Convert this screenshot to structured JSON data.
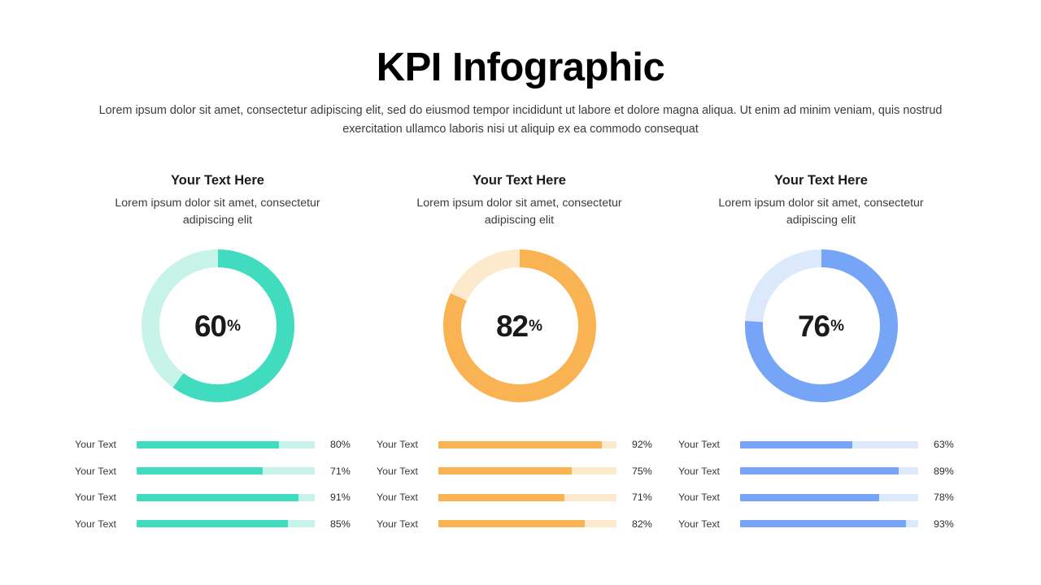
{
  "header": {
    "title": "KPI Infographic",
    "subtitle": "Lorem ipsum dolor sit amet, consectetur adipiscing elit, sed do eiusmod tempor incididunt ut labore et dolore magna aliqua. Ut enim ad minim veniam, quis nostrud exercitation ullamco laboris nisi ut aliquip ex ea commodo consequat"
  },
  "chart_data": {
    "type": "pie",
    "title": "KPI Infographic",
    "columns": [
      {
        "title": "Your Text Here",
        "description": "Lorem ipsum dolor sit amet, consectetur adipiscing elit",
        "donut": {
          "value": 60,
          "value_label": "60",
          "unit": "%"
        },
        "color": "#41dcc0",
        "track_color": "#c8f3e8",
        "bars": [
          {
            "label": "Your Text",
            "value": 80,
            "value_label": "80%"
          },
          {
            "label": "Your Text",
            "value": 71,
            "value_label": "71%"
          },
          {
            "label": "Your Text",
            "value": 91,
            "value_label": "91%"
          },
          {
            "label": "Your Text",
            "value": 85,
            "value_label": "85%"
          }
        ]
      },
      {
        "title": "Your Text Here",
        "description": "Lorem ipsum dolor sit amet, consectetur adipiscing elit",
        "donut": {
          "value": 82,
          "value_label": "82",
          "unit": "%"
        },
        "color": "#f9b352",
        "track_color": "#fde9cb",
        "bars": [
          {
            "label": "Your Text",
            "value": 92,
            "value_label": "92%"
          },
          {
            "label": "Your Text",
            "value": 75,
            "value_label": "75%"
          },
          {
            "label": "Your Text",
            "value": 71,
            "value_label": "71%"
          },
          {
            "label": "Your Text",
            "value": 82,
            "value_label": "82%"
          }
        ]
      },
      {
        "title": "Your Text Here",
        "description": "Lorem ipsum dolor sit amet, consectetur adipiscing elit",
        "donut": {
          "value": 76,
          "value_label": "76",
          "unit": "%"
        },
        "color": "#76a4f7",
        "track_color": "#dce9fc",
        "bars": [
          {
            "label": "Your Text",
            "value": 63,
            "value_label": "63%"
          },
          {
            "label": "Your Text",
            "value": 89,
            "value_label": "89%"
          },
          {
            "label": "Your Text",
            "value": 78,
            "value_label": "78%"
          },
          {
            "label": "Your Text",
            "value": 93,
            "value_label": "93%"
          }
        ]
      }
    ],
    "legend": "none",
    "grid": false
  }
}
